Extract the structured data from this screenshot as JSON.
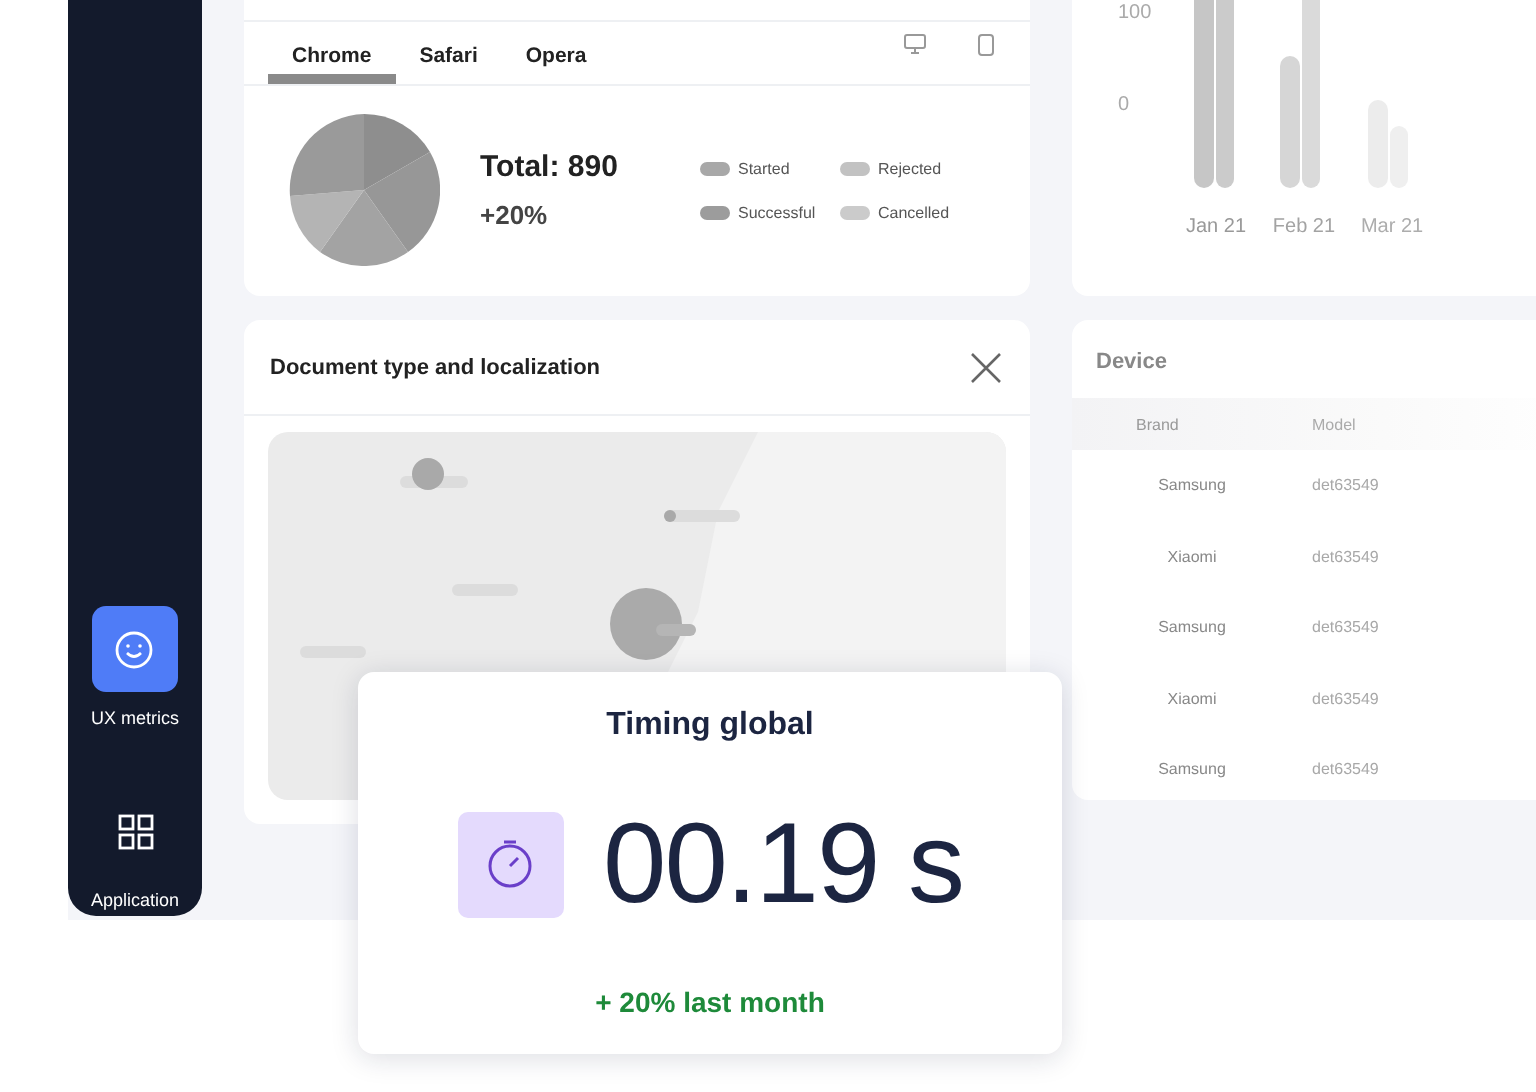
{
  "sidebar": {
    "items": [
      {
        "label": "UX metrics",
        "kind": "smile",
        "selected": true
      },
      {
        "label": "Application",
        "kind": "grid",
        "selected": false
      }
    ]
  },
  "browser_card": {
    "tabs": [
      {
        "label": "Chrome",
        "selected": true
      },
      {
        "label": "Safari",
        "selected": false
      },
      {
        "label": "Opera",
        "selected": false
      }
    ],
    "total": "Total: 890",
    "change": "+20%",
    "legend": [
      {
        "label": "Started",
        "color": "#a8a8a8"
      },
      {
        "label": "Rejected",
        "color": "#c2c2c2"
      },
      {
        "label": "Successful",
        "color": "#9c9c9c"
      },
      {
        "label": "Cancelled",
        "color": "#cbcbcb"
      }
    ]
  },
  "trend_card": {
    "axis_labels": [
      "100",
      "0"
    ],
    "months": [
      "Jan 21",
      "Feb 21",
      "Mar 21"
    ]
  },
  "map_card": {
    "title": "Document type and localization"
  },
  "device_card": {
    "title": "Device",
    "columns": [
      "Brand",
      "Model"
    ],
    "rows": [
      {
        "brand": "Samsung",
        "model": "det63549"
      },
      {
        "brand": "Xiaomi",
        "model": "det63549"
      },
      {
        "brand": "Samsung",
        "model": "det63549"
      },
      {
        "brand": "Xiaomi",
        "model": "det63549"
      },
      {
        "brand": "Samsung",
        "model": "det63549"
      }
    ]
  },
  "timing_card": {
    "title": "Timing global",
    "value": "00.19 s",
    "change": "+ 20% last month"
  }
}
